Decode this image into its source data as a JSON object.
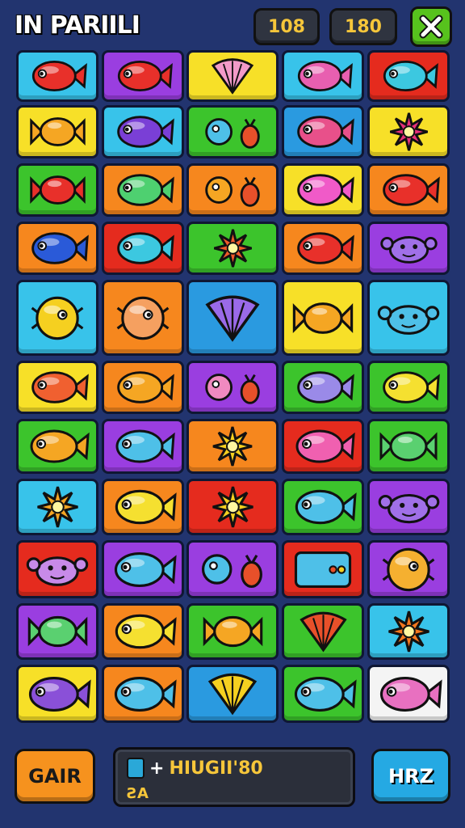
{
  "header": {
    "title": "IN PARIILI",
    "counter_1": "108",
    "counter_2": "180"
  },
  "board": {
    "rows": 11,
    "cols": 5,
    "tiles": [
      [
        "cyan",
        "fish",
        "#e8302a"
      ],
      [
        "purple",
        "fish",
        "#e8302a"
      ],
      [
        "yellow",
        "shell",
        "#f29ac8"
      ],
      [
        "cyan",
        "fish",
        "#e85fb0"
      ],
      [
        "red",
        "fish",
        "#3cc8e0"
      ],
      [
        "yellow",
        "candy",
        "#f5a623"
      ],
      [
        "cyan",
        "fish",
        "#7a3fd6"
      ],
      [
        "green",
        "duo",
        "#4ec0e8"
      ],
      [
        "blue",
        "fish",
        "#e8508a"
      ],
      [
        "yellow",
        "burst",
        "#e8307a"
      ],
      [
        "green",
        "candy",
        "#e8302a"
      ],
      [
        "orange",
        "fish",
        "#4ed070"
      ],
      [
        "orange",
        "duo",
        "#f5a623"
      ],
      [
        "yellow",
        "fish",
        "#f05ac8"
      ],
      [
        "orange",
        "fish",
        "#e8302a"
      ],
      [
        "orange",
        "fish",
        "#2a5ad8"
      ],
      [
        "red",
        "fish",
        "#3cc8e0"
      ],
      [
        "green",
        "burst",
        "#f05a2a"
      ],
      [
        "orange",
        "fish",
        "#e8302a"
      ],
      [
        "purple",
        "crab",
        "#a070e8"
      ],
      [
        "cyan",
        "puffer",
        "#f5d020"
      ],
      [
        "orange",
        "puffer",
        "#f5a060"
      ],
      [
        "blue",
        "shell",
        "#9a6ae8"
      ],
      [
        "yellow",
        "candy",
        "#f5a623"
      ],
      [
        "cyan",
        "crab",
        "#4ec0e8"
      ],
      [
        "yellow",
        "fish",
        "#f06030"
      ],
      [
        "orange",
        "fish",
        "#f5a623"
      ],
      [
        "purple",
        "duo",
        "#f08ac0"
      ],
      [
        "green",
        "fish",
        "#9a8ae8"
      ],
      [
        "green",
        "fish",
        "#f5e030"
      ],
      [
        "green",
        "fish",
        "#f5a623"
      ],
      [
        "purple",
        "fish",
        "#4ec0e8"
      ],
      [
        "orange",
        "burst",
        "#f5d020"
      ],
      [
        "red",
        "fish",
        "#f060b0"
      ],
      [
        "green",
        "candy",
        "#5ad070"
      ],
      [
        "cyan",
        "burst",
        "#f5a623"
      ],
      [
        "orange",
        "fish",
        "#f5e030"
      ],
      [
        "red",
        "burst",
        "#f5d020"
      ],
      [
        "green",
        "fish",
        "#4ec0e8"
      ],
      [
        "purple",
        "crab",
        "#a070e8"
      ],
      [
        "red",
        "crab",
        "#c88ae8"
      ],
      [
        "purple",
        "fish",
        "#4ec0e8"
      ],
      [
        "purple",
        "duo",
        "#4ec0e8"
      ],
      [
        "red",
        "box",
        "#4ec0e8"
      ],
      [
        "purple",
        "puffer",
        "#f5b030"
      ],
      [
        "purple",
        "candy",
        "#5ad070"
      ],
      [
        "orange",
        "fish",
        "#f5e030"
      ],
      [
        "green",
        "candy",
        "#f5a623"
      ],
      [
        "green",
        "shell",
        "#e8502a"
      ],
      [
        "cyan",
        "burst",
        "#f5781e"
      ],
      [
        "yellow",
        "fish",
        "#8a50d8"
      ],
      [
        "orange",
        "fish",
        "#4ec0e8"
      ],
      [
        "blue",
        "shell",
        "#f5d020"
      ],
      [
        "green",
        "fish",
        "#4ec0e8"
      ],
      [
        "white",
        "fish",
        "#e870c0"
      ]
    ]
  },
  "colors": {
    "cyan": "#38c3ea",
    "purple": "#9a3ee0",
    "yellow": "#f7e028",
    "green": "#3cc42c",
    "red": "#e52b1e",
    "orange": "#f6871e",
    "blue": "#2a9ae0",
    "white": "#f4f4f4"
  },
  "footer": {
    "left_button": "GAIR",
    "message_main": "HIUGII'80",
    "message_sub": "ƧA",
    "right_button": "HRZ"
  }
}
